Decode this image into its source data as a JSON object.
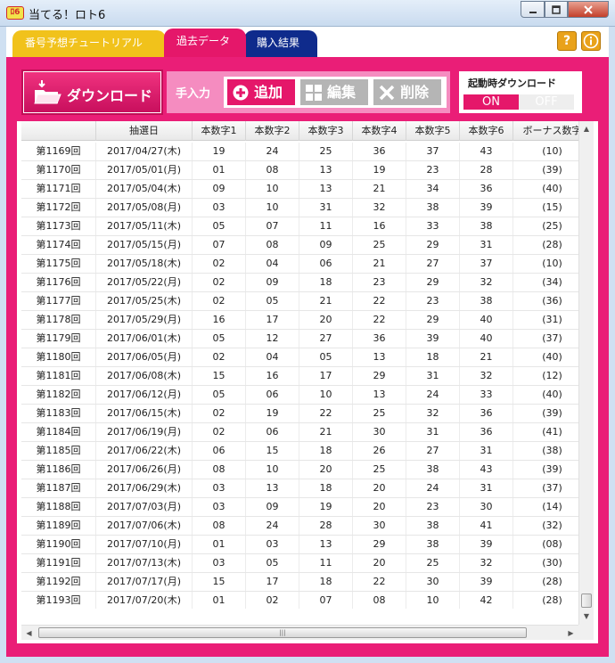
{
  "window": {
    "title": "当てる！ロト6",
    "app_icon_text": "ﾛ6"
  },
  "tabs": [
    {
      "label": "番号予想チュートリアル"
    },
    {
      "label": "過去データ"
    },
    {
      "label": "購入結果"
    }
  ],
  "toolbar": {
    "download_label": "ダウンロード",
    "manual_label": "手入力",
    "add_label": "追加",
    "edit_label": "編集",
    "delete_label": "削除",
    "startup_label": "起動時ダウンロード",
    "toggle_on": "ON",
    "toggle_off": "OFF"
  },
  "colors": {
    "accent": "#e5176a",
    "tutorial_tab": "#f1c21b",
    "purchase_tab": "#0f2b8c"
  },
  "table": {
    "columns": [
      "",
      "抽選日",
      "本数字1",
      "本数字2",
      "本数字3",
      "本数字4",
      "本数字5",
      "本数字6",
      "ボーナス数字"
    ],
    "rows": [
      [
        "第1169回",
        "2017/04/27(木)",
        "19",
        "24",
        "25",
        "36",
        "37",
        "43",
        "(10)"
      ],
      [
        "第1170回",
        "2017/05/01(月)",
        "01",
        "08",
        "13",
        "19",
        "23",
        "28",
        "(39)"
      ],
      [
        "第1171回",
        "2017/05/04(木)",
        "09",
        "10",
        "13",
        "21",
        "34",
        "36",
        "(40)"
      ],
      [
        "第1172回",
        "2017/05/08(月)",
        "03",
        "10",
        "31",
        "32",
        "38",
        "39",
        "(15)"
      ],
      [
        "第1173回",
        "2017/05/11(木)",
        "05",
        "07",
        "11",
        "16",
        "33",
        "38",
        "(25)"
      ],
      [
        "第1174回",
        "2017/05/15(月)",
        "07",
        "08",
        "09",
        "25",
        "29",
        "31",
        "(28)"
      ],
      [
        "第1175回",
        "2017/05/18(木)",
        "02",
        "04",
        "06",
        "21",
        "27",
        "37",
        "(10)"
      ],
      [
        "第1176回",
        "2017/05/22(月)",
        "02",
        "09",
        "18",
        "23",
        "29",
        "32",
        "(34)"
      ],
      [
        "第1177回",
        "2017/05/25(木)",
        "02",
        "05",
        "21",
        "22",
        "23",
        "38",
        "(36)"
      ],
      [
        "第1178回",
        "2017/05/29(月)",
        "16",
        "17",
        "20",
        "22",
        "29",
        "40",
        "(31)"
      ],
      [
        "第1179回",
        "2017/06/01(木)",
        "05",
        "12",
        "27",
        "36",
        "39",
        "40",
        "(37)"
      ],
      [
        "第1180回",
        "2017/06/05(月)",
        "02",
        "04",
        "05",
        "13",
        "18",
        "21",
        "(40)"
      ],
      [
        "第1181回",
        "2017/06/08(木)",
        "15",
        "16",
        "17",
        "29",
        "31",
        "32",
        "(12)"
      ],
      [
        "第1182回",
        "2017/06/12(月)",
        "05",
        "06",
        "10",
        "13",
        "24",
        "33",
        "(40)"
      ],
      [
        "第1183回",
        "2017/06/15(木)",
        "02",
        "19",
        "22",
        "25",
        "32",
        "36",
        "(39)"
      ],
      [
        "第1184回",
        "2017/06/19(月)",
        "02",
        "06",
        "21",
        "30",
        "31",
        "36",
        "(41)"
      ],
      [
        "第1185回",
        "2017/06/22(木)",
        "06",
        "15",
        "18",
        "26",
        "27",
        "31",
        "(38)"
      ],
      [
        "第1186回",
        "2017/06/26(月)",
        "08",
        "10",
        "20",
        "25",
        "38",
        "43",
        "(39)"
      ],
      [
        "第1187回",
        "2017/06/29(木)",
        "03",
        "13",
        "18",
        "20",
        "24",
        "31",
        "(37)"
      ],
      [
        "第1188回",
        "2017/07/03(月)",
        "03",
        "09",
        "19",
        "20",
        "23",
        "30",
        "(14)"
      ],
      [
        "第1189回",
        "2017/07/06(木)",
        "08",
        "24",
        "28",
        "30",
        "38",
        "41",
        "(32)"
      ],
      [
        "第1190回",
        "2017/07/10(月)",
        "01",
        "03",
        "13",
        "29",
        "38",
        "39",
        "(08)"
      ],
      [
        "第1191回",
        "2017/07/13(木)",
        "03",
        "05",
        "11",
        "20",
        "25",
        "32",
        "(30)"
      ],
      [
        "第1192回",
        "2017/07/17(月)",
        "15",
        "17",
        "18",
        "22",
        "30",
        "39",
        "(28)"
      ],
      [
        "第1193回",
        "2017/07/20(木)",
        "01",
        "02",
        "07",
        "08",
        "10",
        "42",
        "(28)"
      ]
    ]
  },
  "scroll": {
    "vertical_position": 1.0,
    "horizontal_position": 0.0
  }
}
